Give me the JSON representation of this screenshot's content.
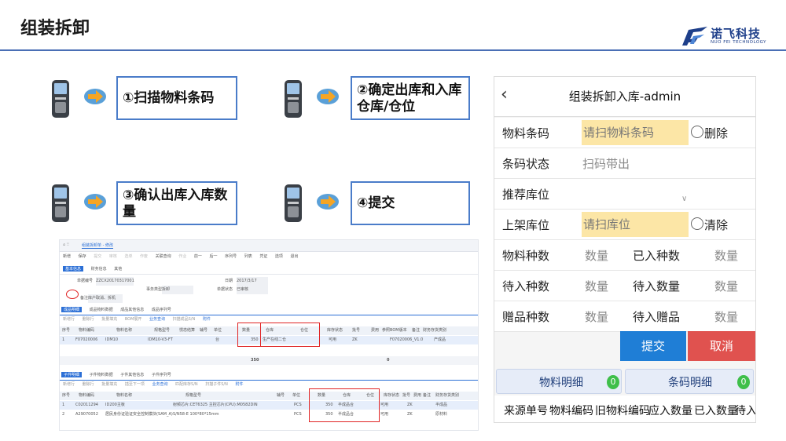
{
  "page": {
    "title": "组装拆卸",
    "logo_name": "诺飞科技",
    "logo_sub": "NUO FEI TECHNOLOGY",
    "brand_color": "#1e3f8a"
  },
  "steps": [
    {
      "label": "①扫描物料条码"
    },
    {
      "label": "②确定出库和入库仓库/仓位"
    },
    {
      "label": "③确认出库入库数量"
    },
    {
      "label": "④提交"
    }
  ],
  "desktop": {
    "breadcrumb": "组装拆卸单 - 修改",
    "toolbar": [
      "新增",
      "保存",
      "提交",
      "审核",
      "选单",
      "作废",
      "关联查询",
      "作业",
      "前一",
      "后一",
      "序列号",
      "列表",
      "凭证",
      "选项",
      "退出"
    ],
    "tabs": [
      "基本信息",
      "财务信息",
      "其他"
    ],
    "header_fields": [
      {
        "label": "单据编号",
        "value": "ZZCX20170317001"
      },
      {
        "label": "事务类型",
        "value": "拆卸"
      },
      {
        "label": "日期",
        "value": "2017/3/17"
      },
      {
        "label": "单据状态",
        "value": "已审核"
      },
      {
        "label": "备注",
        "value": "库户取消、拆机"
      }
    ],
    "section1_tabs": [
      "成品明细",
      "成品物料数据",
      "成品其他信息",
      "成品序列号"
    ],
    "section1_subtoolbar": [
      "新增行",
      "删除行",
      "批量填充",
      "BOM展开",
      "业务查询",
      "扫描成品S/N",
      "附件"
    ],
    "grid1_headers": [
      "序号",
      "物料编码",
      "物料名称",
      "规格型号",
      "惯态结算",
      "辅号",
      "单位",
      "数量",
      "仓库",
      "仓位",
      "库存状态",
      "批号",
      "费用",
      "参照BOM版本",
      "备注",
      "财务存货类别"
    ],
    "grid1_row": [
      "1",
      "F07020006",
      "IDM10",
      "IDM10-V3-FT",
      "台",
      "350",
      "生产在线二仓",
      "可用",
      "ZK",
      "F07020006_V1.0",
      "产成品"
    ],
    "grid1_total": [
      "350",
      "0"
    ],
    "section2_tabs": [
      "子件明细",
      "子件物料数据",
      "子件其他信息",
      "子件序列号"
    ],
    "section2_subtoolbar": [
      "新增行",
      "删除行",
      "批量填充",
      "插至下一项",
      "业务查询",
      "匹配库存S/N",
      "扫描子件S/N",
      "附件"
    ],
    "grid2_headers": [
      "序号",
      "物料编码",
      "物料名称",
      "规格型号",
      "辅号",
      "单位",
      "数量",
      "仓库",
      "仓位",
      "库存状态",
      "批号",
      "费用",
      "备注",
      "财务存货类别"
    ],
    "grid2_rows": [
      [
        "1",
        "C02011294",
        "ID200主板",
        "射频芯片:CET6325 主控芯片(CPU):M0582DIN",
        "PCS",
        "350",
        "半成品合",
        "可用",
        "ZK",
        "半成品"
      ],
      [
        "2",
        "A29070052",
        "居民身份证验证安全控制模块(SAM_A)",
        "S/N58-E 100*80*15mm",
        "PCS",
        "350",
        "半成品合",
        "可用",
        "ZK",
        "原材料"
      ]
    ]
  },
  "mobile": {
    "title": "组装拆卸入库-admin",
    "rows": [
      {
        "label": "物料条码",
        "field": "请扫物料条码",
        "radio": "删除"
      },
      {
        "label": "条码状态",
        "hint": "扫码带出"
      },
      {
        "label": "推荐库位"
      },
      {
        "label": "上架库位",
        "field": "请扫库位",
        "radio": "清除"
      }
    ],
    "stats": [
      {
        "label": "物料种数",
        "value": "数量",
        "label2": "已入种数",
        "value2": "数量"
      },
      {
        "label": "待入种数",
        "value": "数量",
        "label2": "待入数量",
        "value2": "数量"
      },
      {
        "label": "赠品种数",
        "value": "数量",
        "label2": "待入赠品",
        "value2": "数量"
      }
    ],
    "submit": "提交",
    "cancel": "取消",
    "tabs": [
      {
        "label": "物料明细",
        "count": "0"
      },
      {
        "label": "条码明细",
        "count": "0"
      }
    ],
    "columns": [
      "来源单号",
      "物料编码",
      "旧物料编码",
      "应入数量",
      "已入数量",
      "待入"
    ]
  }
}
